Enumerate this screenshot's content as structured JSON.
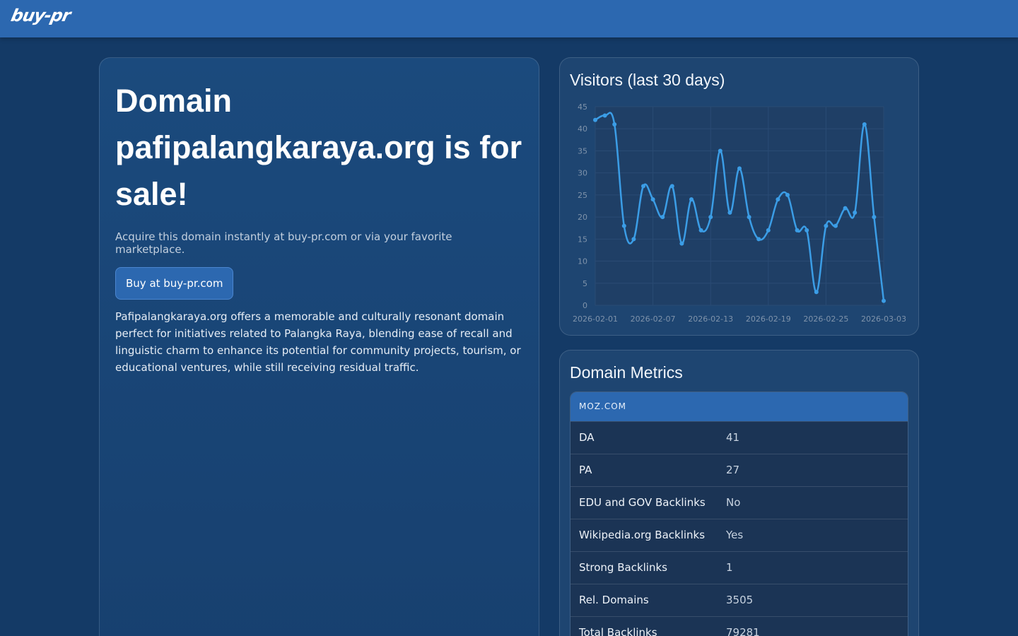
{
  "header": {
    "logo_text": "buy-pr"
  },
  "hero": {
    "headline": "Domain pafipalangkaraya.org is for sale!",
    "subtitle": "Acquire this domain instantly at buy-pr.com or via your favorite marketplace.",
    "buy_button_label": "Buy at buy-pr.com",
    "description": "Pafipalangkaraya.org offers a memorable and culturally resonant domain perfect for initiatives related to Palangka Raya, blending ease of recall and linguistic charm to enhance its potential for community projects, tourism, or educational ventures, while still receiving residual traffic."
  },
  "visitors": {
    "title": "Visitors (last 30 days)"
  },
  "metrics": {
    "title": "Domain Metrics",
    "source": "MOZ.COM",
    "rows": [
      {
        "label": "DA",
        "value": "41"
      },
      {
        "label": "PA",
        "value": "27"
      },
      {
        "label": "EDU and GOV Backlinks",
        "value": "No"
      },
      {
        "label": "Wikipedia.org Backlinks",
        "value": "Yes"
      },
      {
        "label": "Strong Backlinks",
        "value": "1"
      },
      {
        "label": "Rel. Domains",
        "value": "3505"
      },
      {
        "label": "Total Backlinks",
        "value": "79281"
      }
    ]
  },
  "colors": {
    "header": "#2c68b0",
    "background": "#143a66",
    "line": "#3b9de6"
  },
  "chart_data": {
    "type": "line",
    "title": "",
    "xlabel": "",
    "ylabel": "",
    "ylim": [
      0,
      45
    ],
    "yticks": [
      0,
      5,
      10,
      15,
      20,
      25,
      30,
      35,
      40,
      45
    ],
    "xtick_labels": [
      "2026-02-01",
      "2026-02-07",
      "2026-02-13",
      "2026-02-19",
      "2026-02-25",
      "2026-03-03"
    ],
    "x": [
      "2026-02-01",
      "2026-02-02",
      "2026-02-03",
      "2026-02-04",
      "2026-02-05",
      "2026-02-06",
      "2026-02-07",
      "2026-02-08",
      "2026-02-09",
      "2026-02-10",
      "2026-02-11",
      "2026-02-12",
      "2026-02-13",
      "2026-02-14",
      "2026-02-15",
      "2026-02-16",
      "2026-02-17",
      "2026-02-18",
      "2026-02-19",
      "2026-02-20",
      "2026-02-21",
      "2026-02-22",
      "2026-02-23",
      "2026-02-24",
      "2026-02-25",
      "2026-02-26",
      "2026-02-27",
      "2026-02-28",
      "2026-03-01",
      "2026-03-02",
      "2026-03-03"
    ],
    "values": [
      42,
      43,
      41,
      18,
      15,
      27,
      24,
      20,
      27,
      14,
      24,
      17,
      20,
      35,
      21,
      31,
      20,
      15,
      17,
      24,
      25,
      17,
      17,
      3,
      18,
      18,
      22,
      21,
      41,
      20,
      1
    ],
    "grid": true,
    "legend": "none"
  }
}
